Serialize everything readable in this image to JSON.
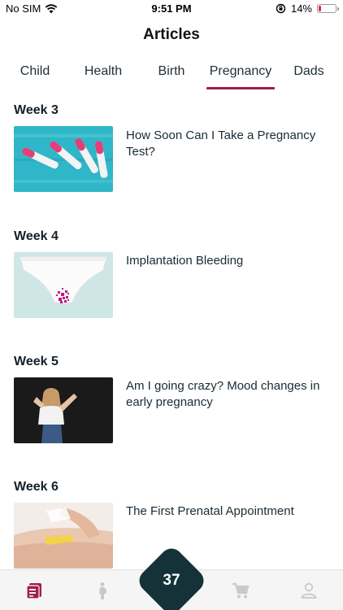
{
  "status": {
    "carrier": "No SIM",
    "time": "9:51 PM",
    "battery": "14%",
    "battery_level": 0.14,
    "icons": [
      "wifi-icon",
      "orientation-lock-icon",
      "battery-icon"
    ]
  },
  "header": {
    "title": "Articles"
  },
  "tabs": [
    {
      "label": "Child"
    },
    {
      "label": "Health"
    },
    {
      "label": "Birth"
    },
    {
      "label": "Pregnancy",
      "active": true
    },
    {
      "label": "Dads"
    }
  ],
  "articles": [
    {
      "week": "Week 3",
      "title": "How Soon Can I Take a Pregnancy Test?",
      "image": "pregnancy-tests-photo"
    },
    {
      "week": "Week 4",
      "title": "Implantation Bleeding",
      "image": "underwear-photo"
    },
    {
      "week": "Week 5",
      "title": "Am I going crazy? Mood changes in early pregnancy",
      "image": "woman-portrait-photo"
    },
    {
      "week": "Week 6",
      "title": "The First Prenatal Appointment",
      "image": "prenatal-exam-photo"
    }
  ],
  "bottom_nav": {
    "current_week": "37",
    "items": [
      "articles-icon",
      "pregnancy-icon",
      "week-badge",
      "shop-cart-icon",
      "profile-icon"
    ]
  },
  "colors": {
    "accent": "#a31d47",
    "badge": "#143238",
    "text": "#1b2a33"
  }
}
